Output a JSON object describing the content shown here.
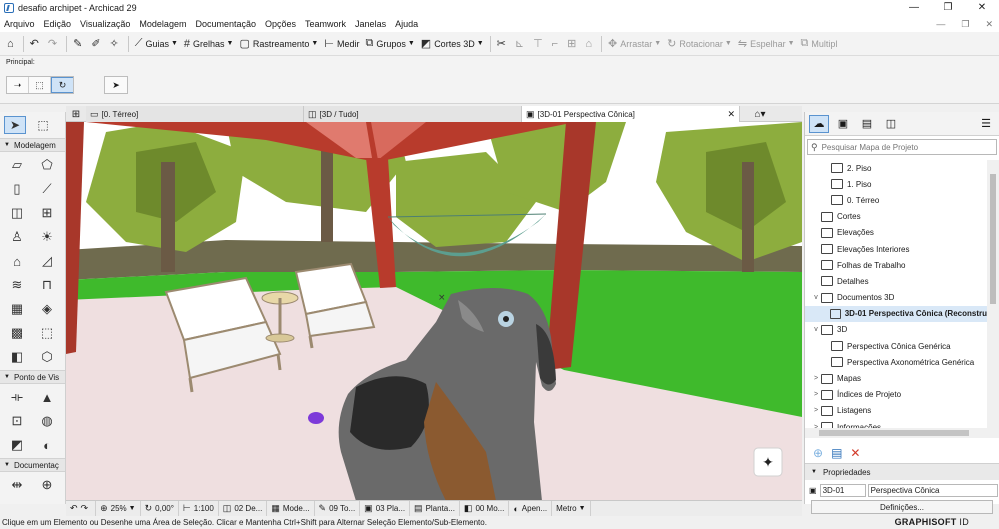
{
  "window": {
    "title": "desafio archipet - Archicad 29",
    "controls": [
      "—",
      "❐",
      "✕"
    ]
  },
  "menubar": {
    "items": [
      "Arquivo",
      "Edição",
      "Visualização",
      "Modelagem",
      "Documentação",
      "Opções",
      "Teamwork",
      "Janelas",
      "Ajuda"
    ],
    "sub_controls": [
      "—",
      "❐",
      "✕"
    ]
  },
  "toolbar": {
    "guias": "Guias",
    "grelhas": "Grelhas",
    "rastreamento": "Rastreamento",
    "medir": "Medir",
    "grupos": "Grupos",
    "cortes3d": "Cortes 3D",
    "arrastar": "Arrastar",
    "rotacionar": "Rotacionar",
    "espelhar": "Espelhar",
    "multiplicar": "Multipl"
  },
  "infobox": {
    "label": "Principal:"
  },
  "toolbox": {
    "sections": {
      "modelagem": "Modelagem",
      "ponto_de_vista": "Ponto de Vis",
      "documentacao": "Documentaç"
    }
  },
  "viewtabs": [
    {
      "label": "[0. Térreo]"
    },
    {
      "label": "[3D / Tudo]"
    },
    {
      "label": "[3D-01 Perspectiva Cônica]"
    }
  ],
  "navigator": {
    "search_placeholder": "Pesquisar Mapa de Projeto",
    "tree": [
      {
        "label": "2. Piso",
        "level": 2,
        "expander": ""
      },
      {
        "label": "1. Piso",
        "level": 2,
        "expander": ""
      },
      {
        "label": "0. Térreo",
        "level": 2,
        "expander": ""
      },
      {
        "label": "Cortes",
        "level": 1,
        "expander": ""
      },
      {
        "label": "Elevações",
        "level": 1,
        "expander": ""
      },
      {
        "label": "Elevações Interiores",
        "level": 1,
        "expander": ""
      },
      {
        "label": "Folhas de Trabalho",
        "level": 1,
        "expander": ""
      },
      {
        "label": "Detalhes",
        "level": 1,
        "expander": ""
      },
      {
        "label": "Documentos 3D",
        "level": 1,
        "expander": "v"
      },
      {
        "label": "3D-01 Perspectiva Cônica (Reconstru",
        "level": 2,
        "expander": "",
        "selected": true
      },
      {
        "label": "3D",
        "level": 1,
        "expander": "v"
      },
      {
        "label": "Perspectiva Cônica Genérica",
        "level": 2,
        "expander": ""
      },
      {
        "label": "Perspectiva Axonométrica Genérica",
        "level": 2,
        "expander": ""
      },
      {
        "label": "Mapas",
        "level": 1,
        "expander": ">"
      },
      {
        "label": "Índices de Projeto",
        "level": 1,
        "expander": ">"
      },
      {
        "label": "Listagens",
        "level": 1,
        "expander": ">"
      },
      {
        "label": "Informações",
        "level": 1,
        "expander": ">"
      }
    ],
    "properties": {
      "header": "Propriedades",
      "id": "3D-01",
      "name": "Perspectiva Cônica",
      "definitions_button": "Definições..."
    }
  },
  "viewbar": {
    "zoom": "25%",
    "angle": "0,00°",
    "scale": "1:100",
    "layer": "02 De...",
    "model": "Mode...",
    "view": "09 To...",
    "plan": "03 Pla...",
    "planta": "Planta...",
    "mo": "00 Mo...",
    "apen": "Apen...",
    "unit": "Metro"
  },
  "statusbar": {
    "message": "Clique em um Elemento ou Desenhe uma Área de Seleção. Clicar e Mantenha Ctrl+Shift para Alternar Seleção Elemento/Sub-Elemento.",
    "brand": "GRAPHISOFT",
    "brand_suffix": " ID"
  },
  "colors": {
    "pergola_wood": "#b83b2c",
    "grass": "#3fba2c",
    "floor": "#efdfe0",
    "foliage": "#8dad3e",
    "accent_blue": "#5a93cf"
  }
}
